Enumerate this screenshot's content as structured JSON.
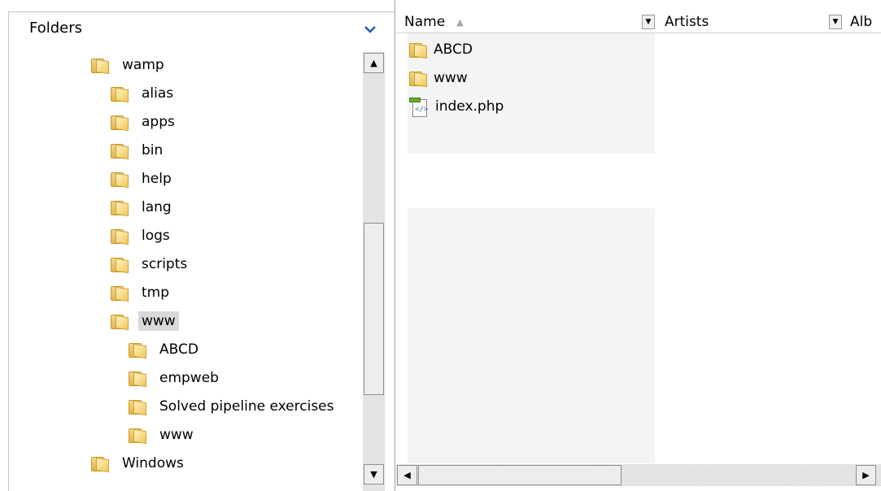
{
  "folders_pane": {
    "title": "Folders",
    "tree": [
      {
        "label": "wamp",
        "level": 0,
        "selected": false
      },
      {
        "label": "alias",
        "level": 1,
        "selected": false
      },
      {
        "label": "apps",
        "level": 1,
        "selected": false
      },
      {
        "label": "bin",
        "level": 1,
        "selected": false
      },
      {
        "label": "help",
        "level": 1,
        "selected": false
      },
      {
        "label": "lang",
        "level": 1,
        "selected": false
      },
      {
        "label": "logs",
        "level": 1,
        "selected": false
      },
      {
        "label": "scripts",
        "level": 1,
        "selected": false
      },
      {
        "label": "tmp",
        "level": 1,
        "selected": false
      },
      {
        "label": "www",
        "level": 1,
        "selected": true
      },
      {
        "label": "ABCD",
        "level": 2,
        "selected": false
      },
      {
        "label": "empweb",
        "level": 2,
        "selected": false
      },
      {
        "label": "Solved pipeline exercises",
        "level": 2,
        "selected": false
      },
      {
        "label": "www",
        "level": 2,
        "selected": false
      },
      {
        "label": "Windows",
        "level": 0,
        "selected": false
      }
    ]
  },
  "list_pane": {
    "columns": [
      {
        "label": "Name"
      },
      {
        "label": "Artists"
      },
      {
        "label": "Alb"
      }
    ],
    "items": [
      {
        "label": "ABCD",
        "icon": "folder-icon"
      },
      {
        "label": "www",
        "icon": "folder-icon"
      },
      {
        "label": "index.php",
        "icon": "php-file-icon"
      }
    ]
  },
  "colors": {
    "selection": "#d9d9d9",
    "chevron": "#1d5bb3"
  }
}
